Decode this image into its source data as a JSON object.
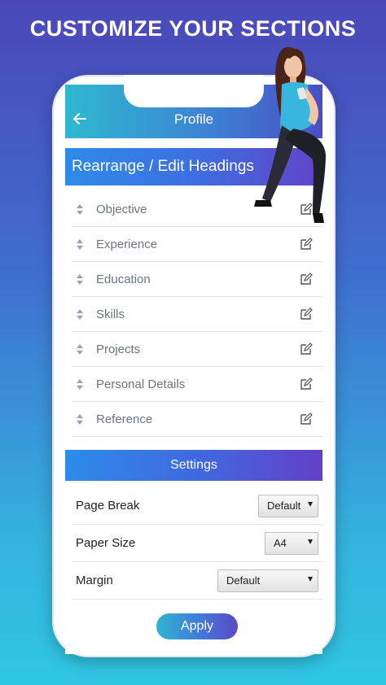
{
  "headline": "CUSTOMIZE YOUR SECTIONS",
  "appbar": {
    "title": "Profile"
  },
  "section_header": "Rearrange / Edit Headings",
  "sections": [
    {
      "label": "Objective"
    },
    {
      "label": "Experience"
    },
    {
      "label": "Education"
    },
    {
      "label": "Skills"
    },
    {
      "label": "Projects"
    },
    {
      "label": "Personal Details"
    },
    {
      "label": "Reference"
    }
  ],
  "settings": {
    "title": "Settings",
    "page_break": {
      "label": "Page Break",
      "value": "Default"
    },
    "paper_size": {
      "label": "Paper Size",
      "value": "A4"
    },
    "margin": {
      "label": "Margin",
      "value": "Default"
    }
  },
  "apply_label": "Apply",
  "icons": {
    "back": "arrow-left-icon",
    "drag": "drag-handle-icon",
    "edit": "edit-icon",
    "dropdown": "chevron-down-icon"
  },
  "colors": {
    "background_top": "#4b47b9",
    "background_bottom": "#2fc6e3",
    "accent_blue": "#2e8be8",
    "accent_purple": "#6342c8"
  }
}
